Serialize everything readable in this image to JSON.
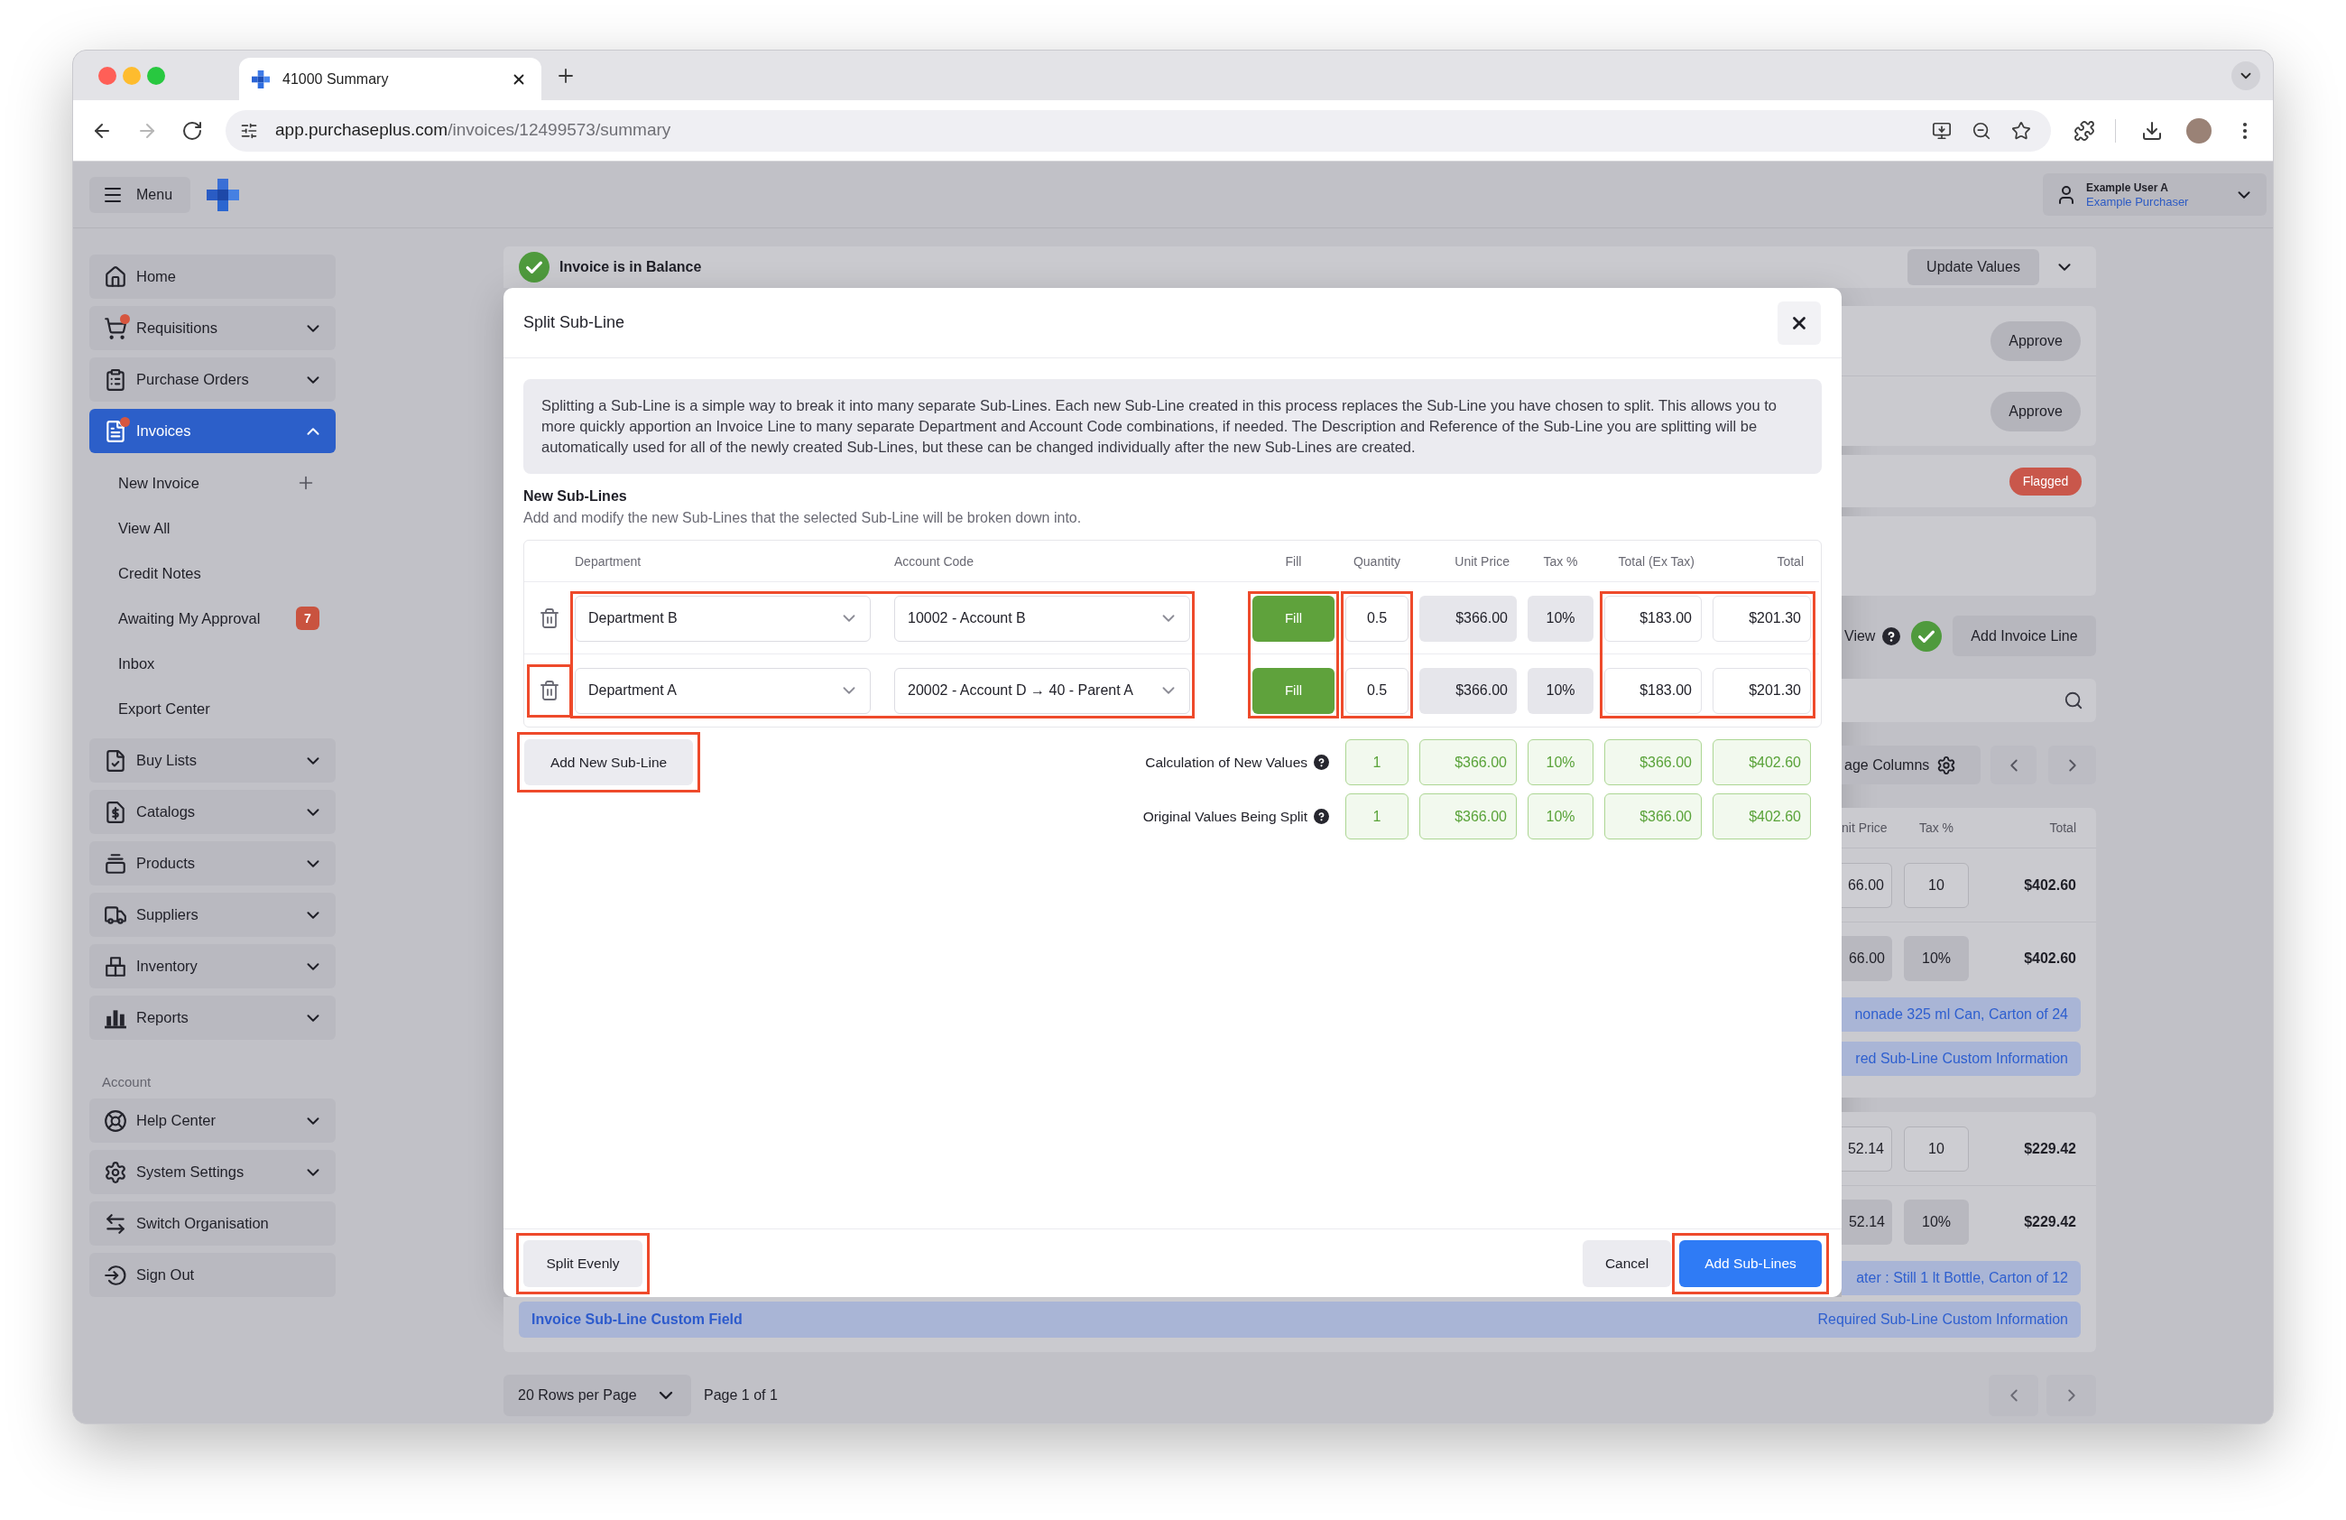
{
  "browser": {
    "tab_title": "41000 Summary",
    "url_host": "app.purchaseplus.com",
    "url_path": "/invoices/12499573/summary"
  },
  "header": {
    "menu_label": "Menu",
    "user_name": "Example User A",
    "user_role": "Example Purchaser"
  },
  "sidebar": {
    "items": [
      {
        "label": "Home",
        "kind": "link",
        "selected": false,
        "alert": false
      },
      {
        "label": "Requisitions",
        "kind": "group",
        "selected": false,
        "alert": true,
        "expanded": false
      },
      {
        "label": "Purchase Orders",
        "kind": "group",
        "selected": false,
        "alert": false,
        "expanded": false
      },
      {
        "label": "Invoices",
        "kind": "group",
        "selected": true,
        "alert": true,
        "expanded": true,
        "children": [
          {
            "label": "New Invoice",
            "kind": "create",
            "selected": false
          },
          {
            "label": "View All",
            "kind": "link",
            "selected": false
          },
          {
            "label": "Credit Notes",
            "kind": "link",
            "selected": false
          },
          {
            "label": "Awaiting My Approval",
            "kind": "count",
            "badge": "7",
            "selected": false
          },
          {
            "label": "Inbox",
            "kind": "link",
            "selected": false
          },
          {
            "label": "Export Center",
            "kind": "link",
            "selected": false
          }
        ]
      },
      {
        "label": "Buy Lists",
        "kind": "group",
        "selected": false,
        "alert": false,
        "expanded": false
      },
      {
        "label": "Catalogs",
        "kind": "group",
        "selected": false,
        "alert": false,
        "expanded": false
      },
      {
        "label": "Products",
        "kind": "group",
        "selected": false,
        "alert": false,
        "expanded": false
      },
      {
        "label": "Suppliers",
        "kind": "group",
        "selected": false,
        "alert": false,
        "expanded": false
      },
      {
        "label": "Inventory",
        "kind": "group",
        "selected": false,
        "alert": false,
        "expanded": false
      },
      {
        "label": "Reports",
        "kind": "group",
        "selected": false,
        "alert": false,
        "expanded": false
      }
    ],
    "account_heading": "Account",
    "account_items": [
      {
        "label": "Help Center",
        "kind": "group",
        "selected": false,
        "alert": false,
        "expanded": false
      },
      {
        "label": "System Settings",
        "kind": "group",
        "selected": false,
        "alert": false,
        "expanded": false
      },
      {
        "label": "Switch Organisation",
        "kind": "link",
        "selected": false,
        "alert": false
      },
      {
        "label": "Sign Out",
        "kind": "link",
        "selected": false,
        "alert": false
      }
    ]
  },
  "invoice": {
    "balance": {
      "status": "Invoice is in Balance",
      "button": "Update Values"
    },
    "approvals": [
      {
        "button": "Approve"
      },
      {
        "button": "Approve"
      }
    ],
    "flag": "Flagged",
    "view_label": "View",
    "view_toggle_on": true,
    "add_line_button": "Add Invoice Line",
    "columns_button": "age Columns",
    "columns": [
      "nit Price",
      "Tax %",
      "Total"
    ],
    "lines": [
      {
        "rows": [
          {
            "kind": "line",
            "unit_price": "66.00",
            "tax": "10",
            "total": "$402.60"
          },
          {
            "kind": "sub_line",
            "unit_price": "66.00",
            "tax": "10%",
            "total": "$402.60"
          }
        ],
        "notes": [
          "nonade 325 ml Can, Carton of 24",
          "red Sub-Line Custom Information"
        ]
      },
      {
        "rows": [
          {
            "kind": "line",
            "unit_price": "52.14",
            "tax": "10",
            "total": "$229.42"
          },
          {
            "kind": "sub_line",
            "unit_price": "52.14",
            "tax": "10%",
            "total": "$229.42"
          }
        ],
        "notes": [
          "ater : Still 1 lt Bottle, Carton of 12"
        ],
        "custom_field": {
          "label": "Invoice Sub-Line Custom Field",
          "value": "Required Sub-Line Custom Information"
        }
      }
    ],
    "pagination": {
      "rows_per_page": "20 Rows per Page",
      "page": "Page 1 of 1"
    }
  },
  "modal": {
    "title": "Split Sub-Line",
    "description": "Splitting a Sub-Line is a simple way to break it into many separate Sub-Lines. Each new Sub-Line created in this process replaces the Sub-Line you have chosen to split. This allows you to more quickly apportion an Invoice Line to many separate Department and Account Code combinations, if needed. The Description and Reference of the Sub-Line you are splitting will be automatically used for all of the newly created Sub-Lines, but these can be changed individually after the new Sub-Lines are created.",
    "section_title": "New Sub-Lines",
    "section_subtitle": "Add and modify the new Sub-Lines that the selected Sub-Line will be broken down into.",
    "column_groups": [
      {
        "highlighted": true,
        "columns": [
          "Department",
          "Account Code"
        ]
      },
      {
        "highlighted": true,
        "columns": [
          "Fill"
        ]
      },
      {
        "highlighted": true,
        "columns": [
          "Quantity"
        ]
      },
      {
        "highlighted": false,
        "columns": [
          "Unit Price",
          "Tax %"
        ]
      },
      {
        "highlighted": true,
        "columns": [
          "Total (Ex Tax)",
          "Total"
        ]
      }
    ],
    "rows": [
      {
        "department": "Department B",
        "account_code": "10002 - Account B",
        "fill": "Fill",
        "quantity": "0.5",
        "unit_price": "$366.00",
        "tax": "10%",
        "total_ex_tax": "$183.00",
        "total": "$201.30",
        "delete_highlighted": false
      },
      {
        "department": "Department A",
        "account_code": "20002 - Account D → 40 - Parent A",
        "fill": "Fill",
        "quantity": "0.5",
        "unit_price": "$366.00",
        "tax": "10%",
        "total_ex_tax": "$183.00",
        "total": "$201.30",
        "delete_highlighted": true
      }
    ],
    "add_button": {
      "label": "Add New Sub-Line",
      "highlighted": true
    },
    "summaries": [
      {
        "label": "Calculation of New Values",
        "quantity": "1",
        "unit_price": "$366.00",
        "tax": "10%",
        "total_ex_tax": "$366.00",
        "total": "$402.60"
      },
      {
        "label": "Original Values Being Split",
        "quantity": "1",
        "unit_price": "$366.00",
        "tax": "10%",
        "total_ex_tax": "$366.00",
        "total": "$402.60"
      }
    ],
    "footer": {
      "split_button": {
        "label": "Split Evenly",
        "highlighted": true
      },
      "cancel_button": {
        "label": "Cancel",
        "highlighted": false
      },
      "submit_button": {
        "label": "Add Sub-Lines",
        "highlighted": true
      }
    }
  }
}
